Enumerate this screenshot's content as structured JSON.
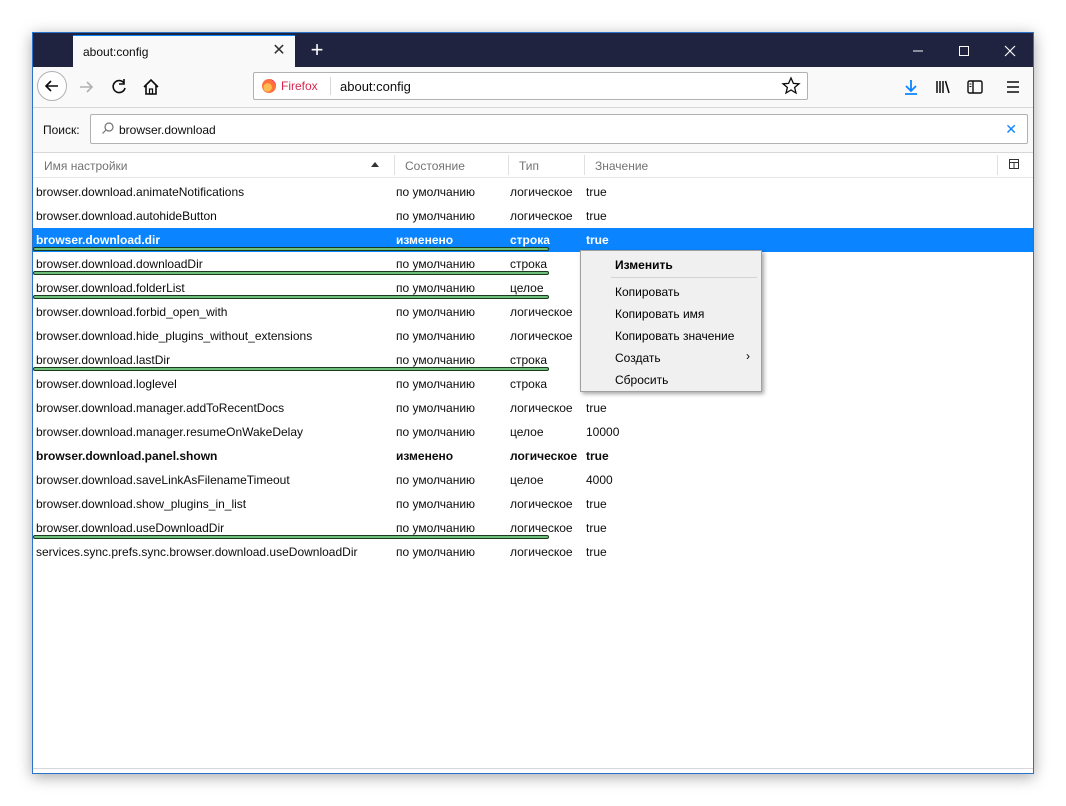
{
  "tab": {
    "title": "about:config",
    "close": "✕"
  },
  "newtab": "+",
  "window_controls": {
    "minimize": "—",
    "maximize": "☐",
    "close": "✕"
  },
  "urlbar": {
    "identity": "Firefox",
    "url": "about:config"
  },
  "search": {
    "label": "Поиск:",
    "value": "browser.download",
    "clear": "✕"
  },
  "columns": {
    "name": "Имя настройки",
    "state": "Состояние",
    "type": "Тип",
    "value": "Значение"
  },
  "rows": [
    {
      "name": "browser.download.animateNotifications",
      "state": "по умолчанию",
      "type": "логическое",
      "value": "true"
    },
    {
      "name": "browser.download.autohideButton",
      "state": "по умолчанию",
      "type": "логическое",
      "value": "true"
    },
    {
      "name": "browser.download.dir",
      "state": "изменено",
      "type": "строка",
      "value": "true"
    },
    {
      "name": "browser.download.downloadDir",
      "state": "по умолчанию",
      "type": "строка",
      "value": ""
    },
    {
      "name": "browser.download.folderList",
      "state": "по умолчанию",
      "type": "целое",
      "value": ""
    },
    {
      "name": "browser.download.forbid_open_with",
      "state": "по умолчанию",
      "type": "логическое",
      "value": ""
    },
    {
      "name": "browser.download.hide_plugins_without_extensions",
      "state": "по умолчанию",
      "type": "логическое",
      "value": ""
    },
    {
      "name": "browser.download.lastDir",
      "state": "по умолчанию",
      "type": "строка",
      "value": ""
    },
    {
      "name": "browser.download.loglevel",
      "state": "по умолчанию",
      "type": "строка",
      "value": ""
    },
    {
      "name": "browser.download.manager.addToRecentDocs",
      "state": "по умолчанию",
      "type": "логическое",
      "value": "true"
    },
    {
      "name": "browser.download.manager.resumeOnWakeDelay",
      "state": "по умолчанию",
      "type": "целое",
      "value": "10000"
    },
    {
      "name": "browser.download.panel.shown",
      "state": "изменено",
      "type": "логическое",
      "value": "true"
    },
    {
      "name": "browser.download.saveLinkAsFilenameTimeout",
      "state": "по умолчанию",
      "type": "целое",
      "value": "4000"
    },
    {
      "name": "browser.download.show_plugins_in_list",
      "state": "по умолчанию",
      "type": "логическое",
      "value": "true"
    },
    {
      "name": "browser.download.useDownloadDir",
      "state": "по умолчанию",
      "type": "логическое",
      "value": "true"
    },
    {
      "name": "services.sync.prefs.sync.browser.download.useDownloadDir",
      "state": "по умолчанию",
      "type": "логическое",
      "value": "true"
    }
  ],
  "context_menu": {
    "modify": "Изменить",
    "copy": "Копировать",
    "copy_name": "Копировать имя",
    "copy_value": "Копировать значение",
    "create": "Создать",
    "create_arrow": "›",
    "reset": "Сбросить"
  },
  "colors": {
    "accent": "#0a84ff",
    "titlebar": "#202340",
    "highlight_underline": "#6dbf7a"
  }
}
